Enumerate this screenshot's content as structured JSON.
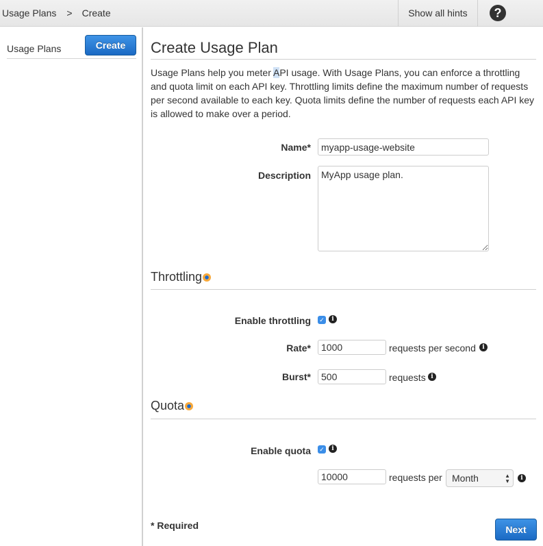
{
  "topbar": {
    "breadcrumb": [
      "Usage Plans",
      "Create"
    ],
    "breadcrumb_separator": ">",
    "hints_label": "Show all hints",
    "help_glyph": "?"
  },
  "sidebar": {
    "title": "Usage Plans",
    "create_label": "Create"
  },
  "main": {
    "title": "Create Usage Plan",
    "intro_pre": "Usage Plans help you meter ",
    "intro_hl": "A",
    "intro_post": "PI usage. With Usage Plans, you can enforce a throttling and quota limit on each API key. Throttling limits define the maximum number of requests per second available to each key. Quota limits define the number of requests each API key is allowed to make over a period.",
    "name_label": "Name*",
    "name_value": "myapp-usage-website",
    "description_label": "Description",
    "description_value": "MyApp usage plan.",
    "throttling": {
      "title": "Throttling",
      "enable_label": "Enable throttling",
      "enabled": true,
      "rate_label": "Rate*",
      "rate_value": "1000",
      "rate_suffix": "requests per second",
      "burst_label": "Burst*",
      "burst_value": "500",
      "burst_suffix": "requests"
    },
    "quota": {
      "title": "Quota",
      "enable_label": "Enable quota",
      "enabled": true,
      "value": "10000",
      "suffix": "requests per",
      "period": "Month"
    },
    "required_note": "* Required",
    "next_label": "Next"
  },
  "icons": {
    "check": "✓",
    "info": "i",
    "select_arrows": "▲▼"
  },
  "colors": {
    "primary_button": "#1b6ac4",
    "checkbox": "#3b8ee8",
    "hint_dot_outer": "#f7a83a",
    "hint_dot_inner": "#1a6ad0"
  }
}
